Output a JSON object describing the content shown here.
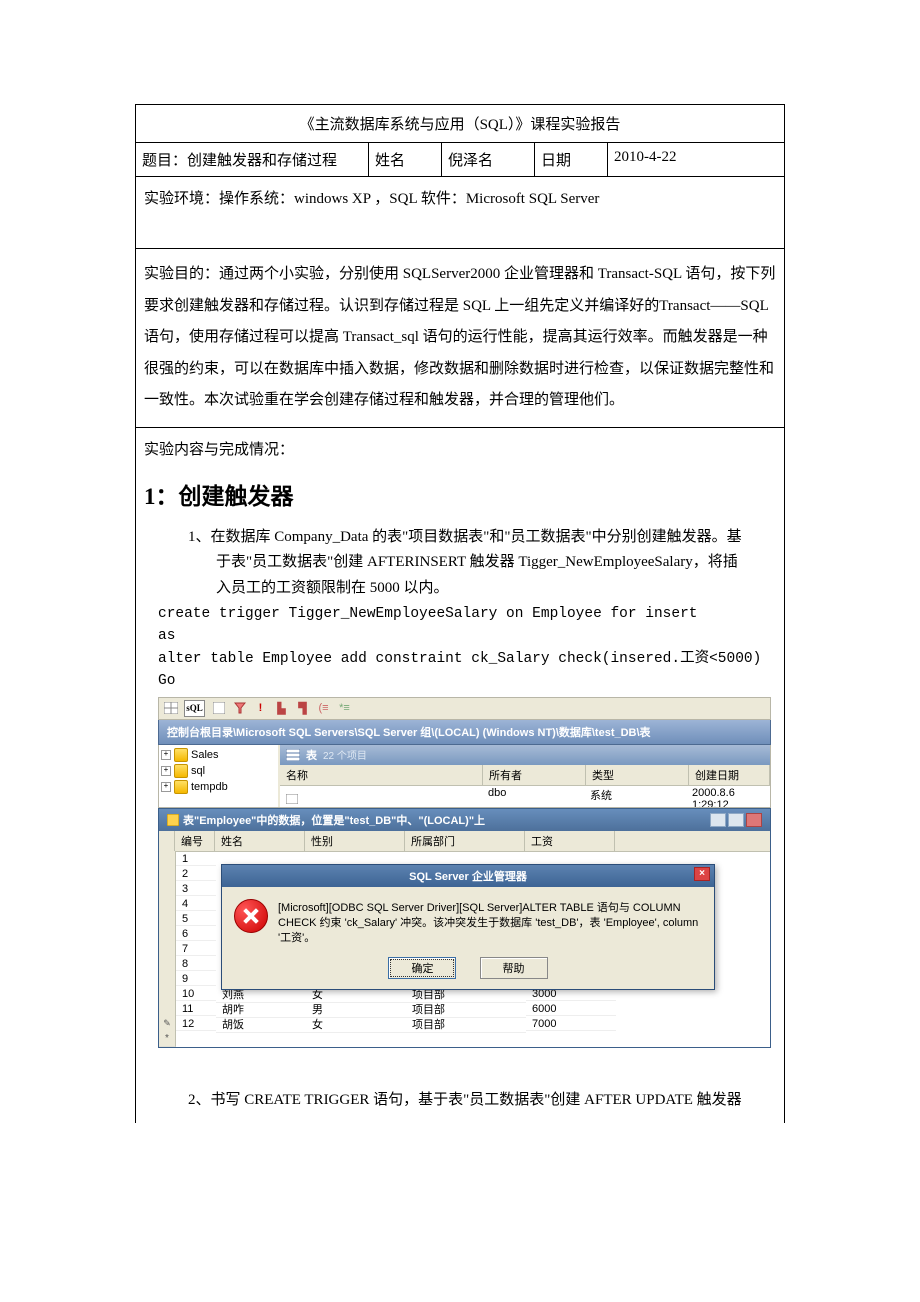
{
  "doc": {
    "title": "《主流数据库系统与应用（SQL）》课程实验报告",
    "row2": {
      "topic_label": "题目：创建触发器和存储过程",
      "name_label": "姓名",
      "name_value": "倪泽名",
      "date_label": "日期",
      "date_value": "2010-4-22"
    },
    "env": "实验环境：操作系统：windows XP ，SQL 软件：Microsoft SQL Server",
    "purpose": "实验目的：通过两个小实验，分别使用 SQLServer2000 企业管理器和 Transact-SQL 语句，按下列要求创建触发器和存储过程。认识到存储过程是 SQL 上一组先定义并编译好的Transact——SQL 语句，使用存储过程可以提高 Transact_sql 语句的运行性能，提高其运行效率。而触发器是一种很强的约束，可以在数据库中插入数据，修改数据和删除数据时进行检查，以保证数据完整性和一致性。本次试验重在学会创建存储过程和触发器，并合理的管理他们。",
    "content_label": "实验内容与完成情况："
  },
  "section1": {
    "heading": "1：创建触发器",
    "item1_l1": "1、在数据库 Company_Data 的表\"项目数据表\"和\"员工数据表\"中分别创建触发器。基",
    "item1_l2": "于表\"员工数据表\"创建 AFTERINSERT  触发器 Tigger_NewEmployeeSalary，将插",
    "item1_l3": "入员工的工资额限制在 5000 以内。",
    "code1": "create trigger Tigger_NewEmployeeSalary on Employee for insert\nas\nalter table Employee add constraint ck_Salary check(insered.工资<5000)\nGo",
    "item2": "2、书写 CREATE TRIGGER 语句，基于表\"员工数据表\"创建 AFTER UPDATE 触发器"
  },
  "sshot": {
    "path": "控制台根目录\\Microsoft SQL Servers\\SQL Server 组\\(LOCAL) (Windows NT)\\数据库\\test_DB\\表",
    "tree": [
      "Sales",
      "sql",
      "tempdb"
    ],
    "list_header_title": "表",
    "list_header_count": "22 个项目",
    "list_cols": {
      "c1": "名称",
      "c2": "所有者",
      "c3": "类型",
      "c4": "创建日期"
    },
    "list_row": {
      "c1": "",
      "c2": "dbo",
      "c3": "系统",
      "c4": "2000.8.6 1:29:12"
    },
    "grid_title": "表\"Employee\"中的数据，位置是\"test_DB\"中、\"(LOCAL)\"上",
    "grid_cols": {
      "c0": "编号",
      "c1": "姓名",
      "c2": "性别",
      "c3": "所属部门",
      "c4": "工资"
    },
    "dialog_title": "SQL Server 企业管理器",
    "dialog_msg": "[Microsoft][ODBC SQL Server Driver][SQL Server]ALTER TABLE 语句与 COLUMN CHECK 约束 'ck_Salary' 冲突。该冲突发生于数据库 'test_DB'，表 'Employee', column '工资'。",
    "btn_ok": "确定",
    "btn_help": "帮助",
    "rows": [
      {
        "n": "1"
      },
      {
        "n": "2"
      },
      {
        "n": "3"
      },
      {
        "n": "4"
      },
      {
        "n": "5"
      },
      {
        "n": "6"
      },
      {
        "n": "7"
      },
      {
        "n": "8"
      },
      {
        "n": "9"
      },
      {
        "n": "10",
        "name": "刘燕",
        "sex": "女",
        "dept": "项目部",
        "sal": "3000"
      },
      {
        "n": "11",
        "name": "胡咋",
        "sex": "男",
        "dept": "项目部",
        "sal": "6000"
      },
      {
        "n": "12",
        "name": "胡饭",
        "sex": "女",
        "dept": "项目部",
        "sal": "7000"
      }
    ],
    "star": "*"
  }
}
